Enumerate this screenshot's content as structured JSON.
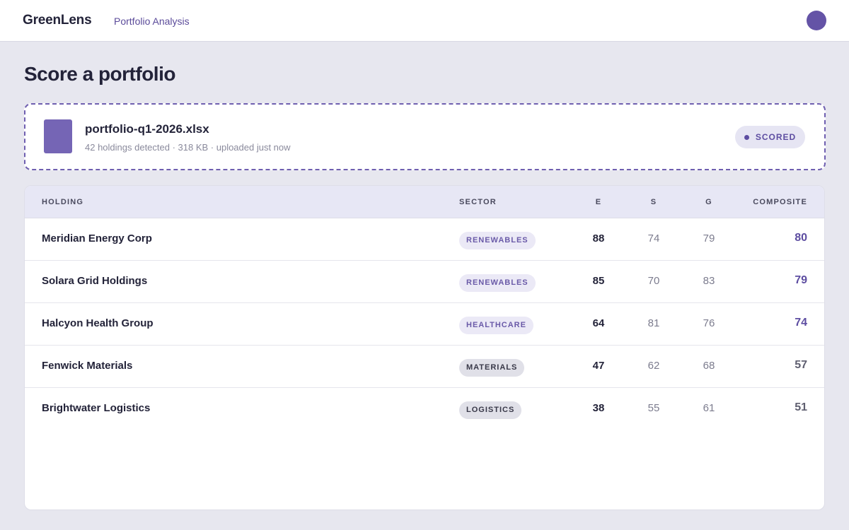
{
  "header": {
    "brand": "GreenLens",
    "nav_link": "Portfolio Analysis"
  },
  "page": {
    "title": "Score a portfolio"
  },
  "upload": {
    "file_name": "portfolio-q1-2026.xlsx",
    "meta": "42 holdings detected · 318 KB · uploaded just now",
    "status": "SCORED"
  },
  "table": {
    "columns": {
      "holding": "HOLDING",
      "sector": "SECTOR",
      "e": "E",
      "s": "S",
      "g": "G",
      "composite": "COMPOSITE"
    },
    "rows": [
      {
        "holding": "Meridian Energy Corp",
        "sector": "RENEWABLES",
        "e": "88",
        "s": "74",
        "g": "79",
        "composite": "80"
      },
      {
        "holding": "Solara Grid Holdings",
        "sector": "RENEWABLES",
        "e": "85",
        "s": "70",
        "g": "83",
        "composite": "79"
      },
      {
        "holding": "Halcyon Health Group",
        "sector": "HEALTHCARE",
        "e": "64",
        "s": "81",
        "g": "76",
        "composite": "74"
      },
      {
        "holding": "Fenwick Materials",
        "sector": "MATERIALS",
        "e": "47",
        "s": "62",
        "g": "68",
        "composite": "57"
      },
      {
        "holding": "Brightwater Logistics",
        "sector": "LOGISTICS",
        "e": "38",
        "s": "55",
        "g": "61",
        "composite": "51"
      }
    ]
  },
  "colors": {
    "accent": "#6453a6",
    "composite_high": "#5d4da1",
    "composite_low": "#5f5f70",
    "background": "#e7e7ef"
  }
}
